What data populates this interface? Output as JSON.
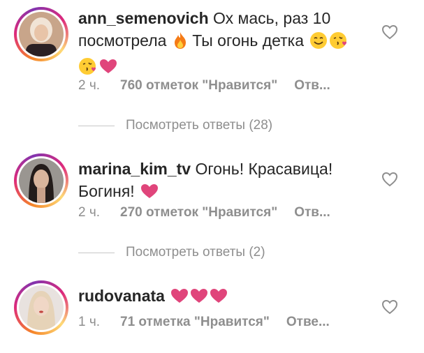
{
  "comments": [
    {
      "username": "ann_semenovich",
      "text_line1": " Ох мась, раз 10",
      "text_line2": "посмотрела ",
      "text_line2b": " Ты огонь детка ",
      "time": "2 ч.",
      "likes": "760 отметок \"Нравится\"",
      "reply": "Отв...",
      "view_replies": "Посмотреть ответы (28)",
      "icons": [
        "fire-emoji",
        "smiling-face-emoji",
        "face-blowing-kiss-emoji",
        "face-blowing-kiss-emoji",
        "pink-heart-emoji"
      ]
    },
    {
      "username": "marina_kim_tv",
      "text_line1": " Огонь! Красавица!",
      "text_line2": "Богиня! ",
      "time": "2 ч.",
      "likes": "270 отметок \"Нравится\"",
      "reply": "Отв...",
      "view_replies": "Посмотреть ответы (2)",
      "icons": [
        "pink-heart-emoji"
      ]
    },
    {
      "username": "rudovanata",
      "text_line1": " ",
      "time": "1 ч.",
      "likes": "71 отметка \"Нравится\"",
      "reply": "Отве...",
      "icons": [
        "pink-heart-emoji",
        "pink-heart-emoji",
        "pink-heart-emoji"
      ]
    }
  ],
  "colors": {
    "text": "#262626",
    "muted": "#8e8e8e",
    "heart_emoji": "#e0457b",
    "story_ring_start": "#f58529",
    "story_ring_end": "#dd2a7b"
  }
}
